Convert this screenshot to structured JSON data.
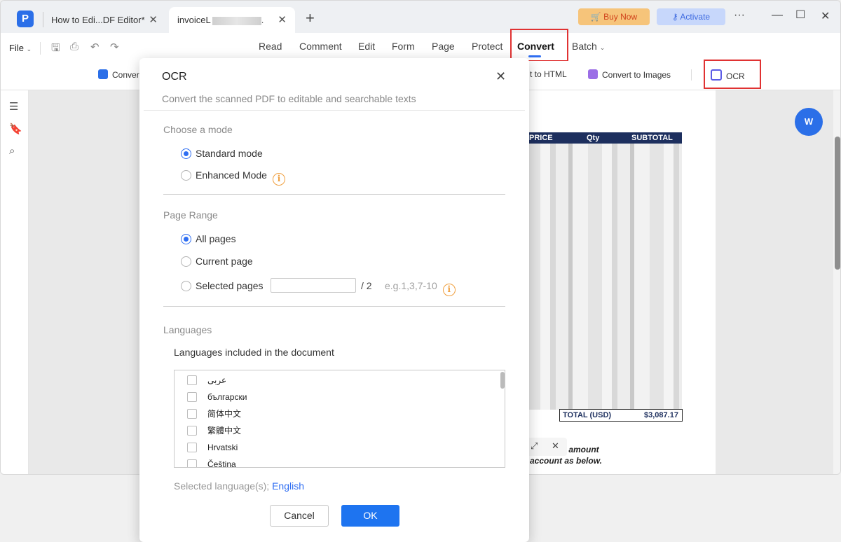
{
  "app": {
    "logo_letter": "P",
    "tabs": [
      {
        "label": "How to Edi...DF Editor*"
      },
      {
        "label": "invoiceL"
      }
    ],
    "new_tab": "+",
    "buy_now": "Buy Now",
    "activate": "Activate",
    "more": "···",
    "minimize": "—",
    "maximize": "☐",
    "close": "✕"
  },
  "menubar": {
    "file": "File",
    "items": [
      "Read",
      "Comment",
      "Edit",
      "Form",
      "Page",
      "Protect",
      "Convert",
      "Batch"
    ],
    "active": "Convert"
  },
  "toolbar": {
    "convert_to_word": "Conver",
    "convert_to_html": "t to HTML",
    "convert_to_images": "Convert to Images",
    "ocr": "OCR"
  },
  "document": {
    "table_headers": [
      "PRICE",
      "Qty",
      "SUBTOTAL"
    ],
    "total_label": "TOTAL (USD)",
    "total_value": "$3,087.17",
    "note_line1": "al amount",
    "note_line2": "account as below.",
    "word_badge": "W"
  },
  "ocr_dialog": {
    "title": "OCR",
    "close": "✕",
    "subtitle": "Convert the scanned PDF to editable and searchable texts",
    "mode": {
      "title": "Choose a mode",
      "options": [
        "Standard mode",
        "Enhanced Mode"
      ],
      "selected": "Standard mode"
    },
    "page_range": {
      "title": "Page Range",
      "options": [
        "All pages",
        "Current page",
        "Selected pages"
      ],
      "selected": "All pages",
      "selected_pages_value": "",
      "total": "/ 2",
      "example": "e.g.1,3,7-10"
    },
    "languages": {
      "title": "Languages",
      "heading": "Languages included in the document",
      "list": [
        "عربى",
        "български",
        "简体中文",
        "繁體中文",
        "Hrvatski",
        "Čeština"
      ],
      "selected_label": "Selected language(s);",
      "selected_value": "English"
    },
    "cancel": "Cancel",
    "ok": "OK"
  },
  "colors": {
    "accent": "#2f6ef2",
    "highlight_box": "#e03232",
    "info": "#f0a040"
  }
}
